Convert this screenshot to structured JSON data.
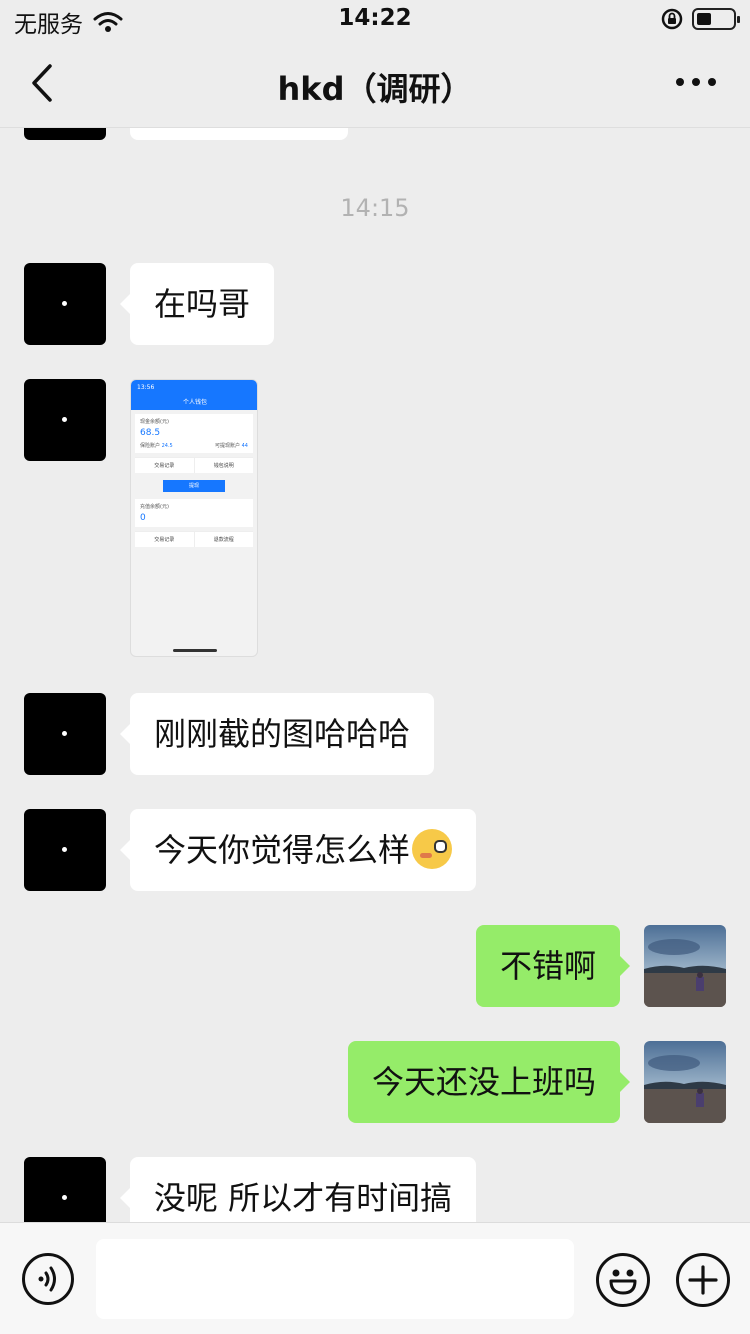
{
  "status_bar": {
    "carrier": "无服务",
    "time": "14:22"
  },
  "header": {
    "title": "hkd（调研）"
  },
  "chat": {
    "timestamp": "14:15",
    "messages": [
      {
        "from": "other",
        "type": "text",
        "text": "在吗哥"
      },
      {
        "from": "other",
        "type": "image",
        "icon": "screenshot-thumbnail"
      },
      {
        "from": "other",
        "type": "text",
        "text": "刚刚截的图哈哈哈"
      },
      {
        "from": "other",
        "type": "text",
        "text": "今天你觉得怎么样",
        "emoji": "wink-emoji"
      },
      {
        "from": "self",
        "type": "text",
        "text": "不错啊"
      },
      {
        "from": "self",
        "type": "text",
        "text": "今天还没上班吗"
      },
      {
        "from": "other",
        "type": "text",
        "text": "没呢  所以才有时间搞"
      }
    ]
  },
  "screenshot_thumb": {
    "time": "13:56",
    "title": "个人钱包",
    "cash_label": "现金余额(元)",
    "cash_value": "68.5",
    "sub_left_label": "保险账户",
    "sub_left_value": "24.5",
    "sub_right_label": "可提现账户",
    "sub_right_value": "44",
    "link_left": "交易记录",
    "link_right": "钱包说明",
    "button": "提现",
    "recharge_label": "充值余额(元)",
    "recharge_value": "0",
    "link2_left": "交易记录",
    "link2_right": "退款流程"
  },
  "composer": {
    "input_value": ""
  },
  "colors": {
    "background": "#ededed",
    "incoming_bubble": "#ffffff",
    "outgoing_bubble": "#95ec69",
    "timestamp": "#b2b2b2",
    "thumb_accent": "#1677ff"
  }
}
